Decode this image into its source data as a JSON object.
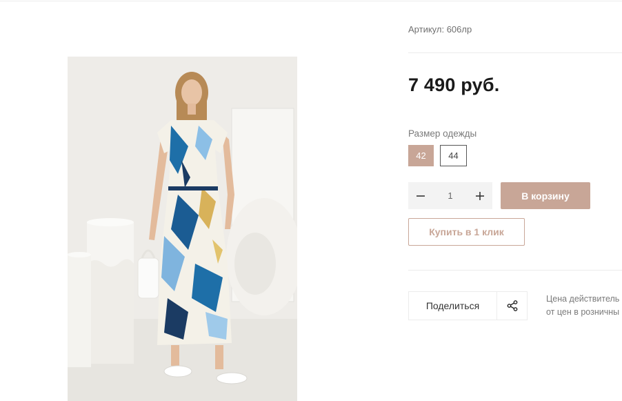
{
  "product": {
    "article": "Артикул: 606лр",
    "price": "7 490 руб.",
    "photo_icon": "product-photo-dress"
  },
  "sizes": {
    "label": "Размер одежды",
    "options": [
      "42",
      "44"
    ],
    "selected": "42"
  },
  "quantity": {
    "value": "1",
    "minus_icon": "minus-icon",
    "plus_icon": "plus-icon"
  },
  "actions": {
    "add_to_cart": "В корзину",
    "buy_one_click": "Купить в 1 клик",
    "share": "Поделиться",
    "share_icon": "share-icon"
  },
  "note": {
    "line1": "Цена действитель",
    "line2": "от цен в розничны"
  },
  "colors": {
    "accent": "#c8a697",
    "divider": "#ececec"
  }
}
